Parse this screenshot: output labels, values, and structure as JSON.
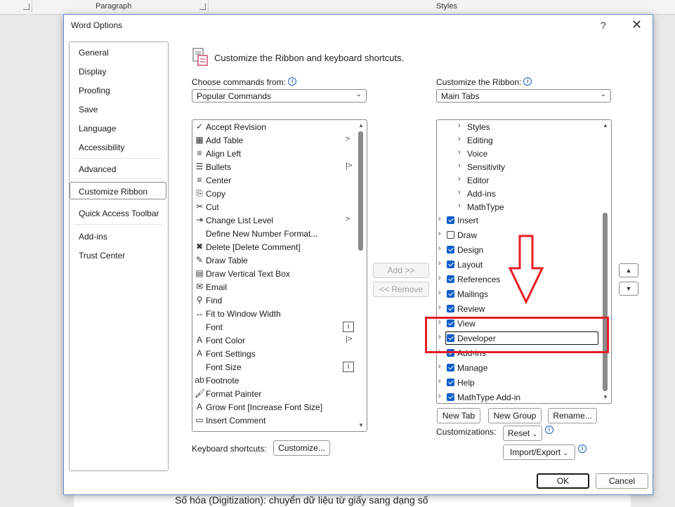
{
  "background": {
    "ribbon_groups": [
      "Paragraph",
      "Styles"
    ],
    "doc_text": "Số hóa (Digitization): chuyển dữ liệu từ giấy sang dạng số"
  },
  "dialog": {
    "title": "Word Options",
    "help": "?",
    "close": "✕"
  },
  "nav": {
    "items": [
      "General",
      "Display",
      "Proofing",
      "Save",
      "Language",
      "Accessibility",
      "Advanced",
      "Customize Ribbon",
      "Quick Access Toolbar",
      "Add-ins",
      "Trust Center"
    ],
    "selected": "Customize Ribbon"
  },
  "header": {
    "title": "Customize the Ribbon and keyboard shortcuts."
  },
  "left": {
    "label": "Choose commands from:",
    "dropdown": "Popular Commands",
    "commands": [
      {
        "icon": "accept-revision-icon",
        "glyph": "✓",
        "label": "Accept Revision",
        "sub": ""
      },
      {
        "icon": "table-icon",
        "glyph": "▦",
        "label": "Add Table",
        "sub": ">"
      },
      {
        "icon": "align-left-icon",
        "glyph": "≡",
        "label": "Align Left",
        "sub": ""
      },
      {
        "icon": "bullets-icon",
        "glyph": "☰",
        "label": "Bullets",
        "sub": "|>"
      },
      {
        "icon": "center-icon",
        "glyph": "≡",
        "label": "Center",
        "sub": ""
      },
      {
        "icon": "copy-icon",
        "glyph": "⎘",
        "label": "Copy",
        "sub": ""
      },
      {
        "icon": "cut-icon",
        "glyph": "✂",
        "label": "Cut",
        "sub": ""
      },
      {
        "icon": "list-level-icon",
        "glyph": "⇥",
        "label": "Change List Level",
        "sub": ">"
      },
      {
        "icon": "",
        "glyph": "",
        "label": "Define New Number Format...",
        "sub": ""
      },
      {
        "icon": "delete-comment-icon",
        "glyph": "✖",
        "label": "Delete [Delete Comment]",
        "sub": ""
      },
      {
        "icon": "draw-table-icon",
        "glyph": "✎",
        "label": "Draw Table",
        "sub": ""
      },
      {
        "icon": "text-box-icon",
        "glyph": "▤",
        "label": "Draw Vertical Text Box",
        "sub": ""
      },
      {
        "icon": "email-icon",
        "glyph": "✉",
        "label": "Email",
        "sub": ""
      },
      {
        "icon": "find-icon",
        "glyph": "⚲",
        "label": "Find",
        "sub": ""
      },
      {
        "icon": "fit-width-icon",
        "glyph": "↔",
        "label": "Fit to Window Width",
        "sub": ""
      },
      {
        "icon": "",
        "glyph": "",
        "label": "Font",
        "sub": "I"
      },
      {
        "icon": "font-color-icon",
        "glyph": "A",
        "label": "Font Color",
        "sub": "|>"
      },
      {
        "icon": "font-settings-icon",
        "glyph": "A",
        "label": "Font Settings",
        "sub": ""
      },
      {
        "icon": "",
        "glyph": "",
        "label": "Font Size",
        "sub": "I"
      },
      {
        "icon": "footnote-icon",
        "glyph": "ab",
        "label": "Footnote",
        "sub": ""
      },
      {
        "icon": "format-painter-icon",
        "glyph": "🖌",
        "label": "Format Painter",
        "sub": ""
      },
      {
        "icon": "grow-font-icon",
        "glyph": "A",
        "label": "Grow Font [Increase Font Size]",
        "sub": ""
      },
      {
        "icon": "insert-comment-icon",
        "glyph": "▭",
        "label": "Insert Comment",
        "sub": ""
      }
    ]
  },
  "right": {
    "label": "Customize the Ribbon:",
    "dropdown": "Main Tabs",
    "tabs": [
      {
        "label": "Styles",
        "level": 2,
        "check": null
      },
      {
        "label": "Editing",
        "level": 2,
        "check": null
      },
      {
        "label": "Voice",
        "level": 2,
        "check": null
      },
      {
        "label": "Sensitivity",
        "level": 2,
        "check": null
      },
      {
        "label": "Editor",
        "level": 2,
        "check": null
      },
      {
        "label": "Add-ins",
        "level": 2,
        "check": null
      },
      {
        "label": "MathType",
        "level": 2,
        "check": null
      },
      {
        "label": "Insert",
        "level": 1,
        "check": true
      },
      {
        "label": "Draw",
        "level": 1,
        "check": false
      },
      {
        "label": "Design",
        "level": 1,
        "check": true
      },
      {
        "label": "Layout",
        "level": 1,
        "check": true
      },
      {
        "label": "References",
        "level": 1,
        "check": true
      },
      {
        "label": "Mailings",
        "level": 1,
        "check": true
      },
      {
        "label": "Review",
        "level": 1,
        "check": true
      },
      {
        "label": "View",
        "level": 1,
        "check": true
      },
      {
        "label": "Developer",
        "level": 1,
        "check": true
      },
      {
        "label": "Add-ins",
        "level": 1,
        "check": true
      },
      {
        "label": "Manage",
        "level": 1,
        "check": true
      },
      {
        "label": "Help",
        "level": 1,
        "check": true
      },
      {
        "label": "MathType Add-in",
        "level": 1,
        "check": true
      }
    ]
  },
  "buttons": {
    "add": "Add >>",
    "remove": "<< Remove",
    "new_tab": "New Tab",
    "new_group": "New Group",
    "rename": "Rename...",
    "customizations": "Customizations:",
    "reset": "Reset",
    "import_export": "Import/Export",
    "keyboard_label": "Keyboard shortcuts:",
    "customize": "Customize...",
    "ok": "OK",
    "cancel": "Cancel"
  },
  "colors": {
    "annotation": "#e81c24",
    "checkbox": "#0f5ec8"
  }
}
